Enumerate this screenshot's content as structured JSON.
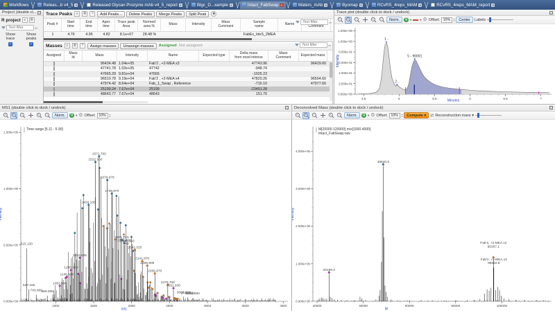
{
  "colors": {
    "accent_blue": "#2f63c0",
    "marker_blue": "#2878a8",
    "marker_magenta": "#cf2bcf",
    "marker_orange": "#e0801f",
    "assigned_green": "#3f9b3f",
    "compute_orange": "#f09a2a",
    "tabbar": "#3c5f8f",
    "region_fill": "#979ccb",
    "axis_title_blue": "#2244bb"
  },
  "filters": {
    "placeholder": "Text filter"
  },
  "tabs": [
    {
      "icon": "workflows-icon",
      "label": "Workflows"
    },
    {
      "icon": "app-icon",
      "label": "Releas...b v4_5",
      "close": "gray"
    },
    {
      "icon": "report-icon",
      "label": "Released Glycan Prozyme mAb v4_5_report",
      "close": "gray"
    },
    {
      "icon": "app-icon",
      "label": "Blgc_D...xample",
      "close": "gray"
    },
    {
      "icon": "app-icon",
      "label": "Intact_FabSwap",
      "active": true,
      "close": "red"
    },
    {
      "icon": "app-icon",
      "label": "Waters_mAb",
      "close": "gray"
    },
    {
      "icon": "app-icon",
      "label": "Byomap",
      "close": "gray"
    },
    {
      "icon": "app-icon",
      "label": "RCvRS_4reps_MAM",
      "close": "gray"
    },
    {
      "icon": "report-icon",
      "label": "RCvRS_4reps_MAM_report",
      "close": "gray"
    }
  ],
  "project_panel": {
    "header": "Project (double cl...",
    "title": "R project",
    "show_trace": "Show\ntrace",
    "show_peaks": "Show\npeaks"
  },
  "trace_peaks": {
    "title": "Trace Peaks",
    "buttons": [
      "Add Peaks...",
      "Delete Peaks",
      "Merge Peaks",
      "Split Peak"
    ],
    "columns": [
      "Peak #",
      "Start\ntime",
      "End\ntime",
      "Apex\ntime",
      "Trace peak\nArea",
      "Normed\narea %",
      "Mass",
      "Intensity",
      "Mass\nComment",
      "Sample\nname",
      "Name",
      "Peak\nComment"
    ],
    "rows": [
      [
        "1",
        "4.76",
        "4.95",
        "4.82",
        "8.1e+07",
        "28.48 %",
        "",
        "",
        "",
        "FabEx_IdeS_2MEA",
        "",
        ""
      ]
    ]
  },
  "masses": {
    "title": "Masses",
    "buttons": [
      "Assign masses",
      "Unassign masses"
    ],
    "assigned_label": "Assigned",
    "not_assigned_label": "Not assigned",
    "columns": [
      "Assigned",
      "Mass\nId",
      "Mass",
      "Intensity",
      "Name",
      "Expected type",
      "Delta mass\nfrom most intense",
      "Mass\nComment",
      "Expected mass"
    ],
    "selected_row": 5,
    "rows": [
      [
        "",
        "",
        "96434.48",
        "1.04e+05",
        "Fab'2 , +2-MEA x3",
        "",
        "47743.96",
        "",
        "96429.60"
      ],
      [
        "",
        "",
        "47741.78",
        "1.02e+05",
        "47742",
        "",
        "-948.74",
        "",
        ""
      ],
      [
        "",
        "",
        "47665.29",
        "9.81e+04",
        "47665",
        "",
        "-1025.23",
        "",
        ""
      ],
      [
        "",
        "",
        "96510.78",
        "9.19e+04",
        "Fab'2 , +2-MEA x4",
        "",
        "47820.26",
        "",
        "96504.60"
      ],
      [
        "",
        "",
        "47974.42",
        "8.64e+04",
        "Fab_1_Swap , Reference",
        "",
        "-716.10",
        "",
        "47977.60"
      ],
      [
        "",
        "",
        "25199.24",
        "7.67e+04",
        "25199",
        "",
        "-23491.28",
        "",
        ""
      ],
      [
        "",
        "",
        "48643.77",
        "7.67e+04",
        "48643",
        "",
        "151.70",
        "",
        ""
      ]
    ]
  },
  "trace_plot": {
    "title": "Trace plot (double click to dock / undock)",
    "toolbar": {
      "norm": "Norm.",
      "q": "Q",
      "offset_label": "Offset:",
      "offset": "10%",
      "center": "Center",
      "labels": "Labels"
    },
    "chart_data": {
      "type": "area",
      "xlabel": "Minutes",
      "ylabel": "Intensity",
      "xmin": 4.38,
      "xmax": 7.15,
      "ymax": 1.26,
      "x_ticks": [
        {
          "v": 4.5,
          "l": "4.5"
        },
        {
          "v": 5,
          "l": "5"
        },
        {
          "v": 5.5,
          "l": "5.5"
        },
        {
          "v": 6,
          "l": "6"
        },
        {
          "v": 6.5,
          "l": "6.5"
        },
        {
          "v": 7,
          "l": "7"
        }
      ],
      "x_minor": 0.1,
      "y_ticks": [
        {
          "v": 0,
          "l": "0.000e+00"
        },
        {
          "v": 0.2,
          "l": "2.000e-01"
        },
        {
          "v": 0.4,
          "l": "4.000e-01"
        },
        {
          "v": 0.6,
          "l": "6.000e-01"
        },
        {
          "v": 0.8,
          "l": "8.000e-01"
        },
        {
          "v": 1.0,
          "l": "1.000e+00"
        },
        {
          "v": 1.2,
          "l": "1.200e+00"
        }
      ],
      "y_minor": 0.1,
      "points": [
        [
          4.42,
          0.005
        ],
        [
          4.55,
          0.01
        ],
        [
          4.62,
          0.02
        ],
        [
          4.68,
          0.04
        ],
        [
          4.72,
          0.1
        ],
        [
          4.75,
          0.3
        ],
        [
          4.78,
          0.72
        ],
        [
          4.8,
          0.93
        ],
        [
          4.82,
          0.97
        ],
        [
          4.84,
          0.9
        ],
        [
          4.86,
          0.68
        ],
        [
          4.88,
          0.45
        ],
        [
          4.9,
          0.3
        ],
        [
          4.93,
          0.2
        ],
        [
          4.95,
          0.155
        ],
        [
          4.97,
          0.165
        ],
        [
          4.99,
          0.155
        ],
        [
          5.01,
          0.13
        ],
        [
          5.04,
          0.105
        ],
        [
          5.06,
          0.09
        ],
        [
          5.08,
          0.085
        ],
        [
          5.1,
          0.09
        ],
        [
          5.12,
          0.13
        ],
        [
          5.14,
          0.22
        ],
        [
          5.16,
          0.38
        ],
        [
          5.18,
          0.52
        ],
        [
          5.2,
          0.61
        ],
        [
          5.22,
          0.65
        ],
        [
          5.24,
          0.63
        ],
        [
          5.27,
          0.55
        ],
        [
          5.3,
          0.46
        ],
        [
          5.33,
          0.38
        ],
        [
          5.36,
          0.32
        ],
        [
          5.4,
          0.27
        ],
        [
          5.45,
          0.22
        ],
        [
          5.5,
          0.185
        ],
        [
          5.55,
          0.16
        ],
        [
          5.6,
          0.14
        ],
        [
          5.7,
          0.115
        ],
        [
          5.8,
          0.1
        ],
        [
          5.88,
          0.09
        ],
        [
          6.0,
          0.075
        ],
        [
          6.1,
          0.065
        ],
        [
          6.2,
          0.06
        ],
        [
          6.4,
          0.05
        ],
        [
          6.6,
          0.042
        ],
        [
          6.8,
          0.036
        ],
        [
          7.0,
          0.032
        ],
        [
          7.12,
          0.03
        ]
      ],
      "region": {
        "from": 5.09,
        "to": 5.88
      },
      "peak_labels": [
        {
          "x": 4.82,
          "y": 0.97,
          "l": "1 -"
        },
        {
          "x": 4.97,
          "y": 0.165,
          "l": "2 -"
        },
        {
          "x": 5.22,
          "y": 0.65,
          "l": "5 - 96691"
        }
      ],
      "vlines": [
        {
          "x": 5.09,
          "h": 0.13,
          "c": "#e02ad0",
          "w": 1
        },
        {
          "x": 5.215,
          "h": 0.18,
          "c": "#1f2d8a",
          "w": 1.4
        },
        {
          "x": 5.85,
          "h": 0.13,
          "c": "#e02ad0",
          "w": 1
        },
        {
          "x": 6.97,
          "h": 0.05,
          "c": "#e02ad0",
          "w": 1
        }
      ]
    }
  },
  "ms1": {
    "title": "MS1 (double click to dock / undock)",
    "toolbar": {
      "norm": "Norm.",
      "q": "Q",
      "offset_label": "Offset:",
      "offset": "10%"
    },
    "chart_data": {
      "type": "spectrum",
      "xlabel": "m/z",
      "xlabel_x": 1900,
      "ylabel": "Intensity",
      "legend": [
        "Time range [5.11 - 5.90]"
      ],
      "xmin": 540,
      "xmax": 4060,
      "ymax": 1550000,
      "x_ticks": [
        {
          "v": 1000,
          "l": "1000"
        },
        {
          "v": 1500,
          "l": "1500"
        },
        {
          "v": 2000,
          "l": "2000"
        },
        {
          "v": 2500,
          "l": "2500"
        },
        {
          "v": 3000,
          "l": "3000"
        },
        {
          "v": 3500,
          "l": "3500"
        },
        {
          "v": 4000,
          "l": "4000"
        }
      ],
      "x_minor": 100,
      "y_ticks": [
        {
          "v": 0,
          "l": "0.000e+00"
        },
        {
          "v": 500000,
          "l": "5.000e+05"
        },
        {
          "v": 1000000,
          "l": "1.000e+06"
        },
        {
          "v": 1500000,
          "l": "1.500e+06"
        }
      ],
      "y_minor": 100000,
      "labeled_peaks": [
        {
          "m": 615.13,
          "v": 470000,
          "l": "615.130"
        },
        {
          "m": 647.165,
          "v": 105000,
          "l": "647.165"
        },
        {
          "m": 743.08,
          "v": 58000,
          "l": "743.080"
        },
        {
          "m": 889.005,
          "v": 50000,
          "l": "889.005"
        },
        {
          "m": 1053.54,
          "v": 120000,
          "l": "1053.540",
          "c": "magenta"
        },
        {
          "m": 1146.43,
          "v": 200000,
          "l": "1146.430",
          "c": "magenta"
        },
        {
          "m": 1200.95,
          "v": 260000,
          "l": "1200.950",
          "c": "magenta"
        },
        {
          "m": 1316.945,
          "v": 370000,
          "l": "1316.945",
          "c": "magenta"
        },
        {
          "m": 1433.105,
          "v": 840000,
          "l": "1433.105",
          "c": "blue"
        },
        {
          "m": 1522.56,
          "v": 1220000,
          "l": "1522.560",
          "c": "blue"
        },
        {
          "m": 1571.7,
          "v": 1270000,
          "l": "1571.700",
          "c": "blue"
        },
        {
          "m": 1679.975,
          "v": 1060000,
          "l": "1679.975",
          "c": "blue"
        },
        {
          "m": 1739.97,
          "v": 940000,
          "l": "1739.970",
          "c": "blue"
        },
        {
          "m": 1871.715,
          "v": 530000,
          "l": "1871.715",
          "c": "blue"
        },
        {
          "m": 1904.095,
          "v": 500000,
          "l": "1904.095",
          "c": "blue"
        },
        {
          "m": 1945.15,
          "v": 495000,
          "l": "1945.150",
          "c": "orange"
        },
        {
          "m": 2042.325,
          "v": 440000,
          "l": "2042.325",
          "c": "orange"
        },
        {
          "m": 2141.87,
          "v": 340000,
          "l": "2141.870",
          "c": "orange"
        },
        {
          "m": 2206.905,
          "v": 300000,
          "l": "2206.905",
          "c": "orange"
        },
        {
          "m": 2306.87,
          "v": 230000,
          "l": "2306.870",
          "c": "orange"
        },
        {
          "m": 2476.76,
          "v": 130000,
          "l": "2476.760",
          "c": "orange"
        },
        {
          "m": 2551.83,
          "v": 100000,
          "l": "2551.830",
          "c": "magenta"
        },
        {
          "m": 2686.3,
          "v": 40000,
          "l": "2686.300"
        },
        {
          "m": 2740.52,
          "v": 35000,
          "l": "2740.520"
        },
        {
          "m": 2806.48,
          "v": 30000,
          "l": "2806.480"
        }
      ],
      "forest": {
        "from": 960,
        "to": 3040,
        "env_center": 1580,
        "env_sigma": 330,
        "env_peak": 1250000,
        "min_space": 5,
        "max_space": 16
      },
      "noise": {
        "from": 545,
        "to": 3900,
        "step": 9,
        "amp": 28000
      }
    }
  },
  "deconvolved": {
    "title": "Deconvolved Mass (double click to dock / undock)",
    "toolbar": {
      "norm": "Norm.",
      "q": "Q",
      "offset_label": "Offset:",
      "offset": "10%",
      "compute": "Compute",
      "recon": "Reconstruction mass"
    },
    "chart_data": {
      "type": "spectrum",
      "xlabel": "M",
      "xlabel_x": 50000,
      "ylabel": "Intensity",
      "legend": [
        "M[20000-120000] m/z[1000-4000]",
        "Intact_FabSwap.raw"
      ],
      "xmin": 18200,
      "xmax": 121500,
      "ymax": 465000,
      "x_ticks": [
        {
          "v": 20000,
          "l": "20000"
        },
        {
          "v": 40000,
          "l": "40000"
        },
        {
          "v": 60000,
          "l": "60000"
        },
        {
          "v": 80000,
          "l": "80000"
        },
        {
          "v": 100000,
          "l": "100000"
        }
      ],
      "x_minor": 4000,
      "y_ticks": [
        {
          "v": 0,
          "l": "0.000e+00"
        },
        {
          "v": 100000,
          "l": "1.000e+05"
        },
        {
          "v": 200000,
          "l": "2.000e+05"
        },
        {
          "v": 300000,
          "l": "3.000e+05"
        },
        {
          "v": 400000,
          "l": "4.000e+05"
        }
      ],
      "y_minor": 25000,
      "peaks": [
        [
          20500,
          5000
        ],
        [
          21200,
          8000
        ],
        [
          21900,
          10000
        ],
        [
          22600,
          9000
        ],
        [
          23400,
          6500
        ],
        [
          24200,
          7000
        ],
        [
          25700,
          12000
        ],
        [
          26400,
          9000
        ],
        [
          27500,
          5500
        ],
        [
          28800,
          4000
        ],
        [
          30500,
          4000
        ],
        [
          33000,
          3000
        ],
        [
          36200,
          3000
        ],
        [
          38600,
          12000
        ],
        [
          39300,
          8000
        ],
        [
          41000,
          3000
        ],
        [
          45500,
          5000
        ],
        [
          46800,
          15000
        ],
        [
          47300,
          30000
        ],
        [
          47900,
          105000
        ],
        [
          48250,
          240000
        ],
        [
          49050,
          170000
        ],
        [
          49420,
          42000
        ],
        [
          49900,
          25000
        ],
        [
          50400,
          12000
        ],
        [
          52000,
          5000
        ],
        [
          55000,
          2500
        ],
        [
          60000,
          2200
        ],
        [
          65000,
          2000
        ],
        [
          70000,
          2000
        ],
        [
          75000,
          2200
        ],
        [
          80000,
          2500
        ],
        [
          85000,
          2500
        ],
        [
          88000,
          3500
        ],
        [
          90500,
          6000
        ],
        [
          92500,
          20000
        ],
        [
          93600,
          32000
        ],
        [
          94500,
          28000
        ],
        [
          95300,
          36000
        ],
        [
          97300,
          30000
        ],
        [
          98300,
          38000
        ],
        [
          99000,
          30000
        ],
        [
          99800,
          15000
        ],
        [
          101000,
          8000
        ],
        [
          103000,
          5000
        ],
        [
          106000,
          3500
        ],
        [
          110000,
          4000
        ],
        [
          115000,
          3000
        ],
        [
          118000,
          2500
        ]
      ],
      "labeled_peaks": [
        {
          "m": 25199.2,
          "v": 72000,
          "l": "25199.2",
          "c": "magenta"
        },
        {
          "m": 48640.5,
          "v": 360000,
          "l": "48640.5",
          "c": "blue"
        },
        {
          "m": 96357.1,
          "v": 112000,
          "l": "Fab'2, +2-MEA x2\n96357.1",
          "c": "orange",
          "lift": 12
        },
        {
          "m": 96510.8,
          "v": 90000,
          "l": "Fab'2, +2-MEA x4\n96510.8"
        }
      ],
      "noise": {
        "from": 18500,
        "to": 120500,
        "step": 600,
        "amp": 2600
      }
    }
  }
}
